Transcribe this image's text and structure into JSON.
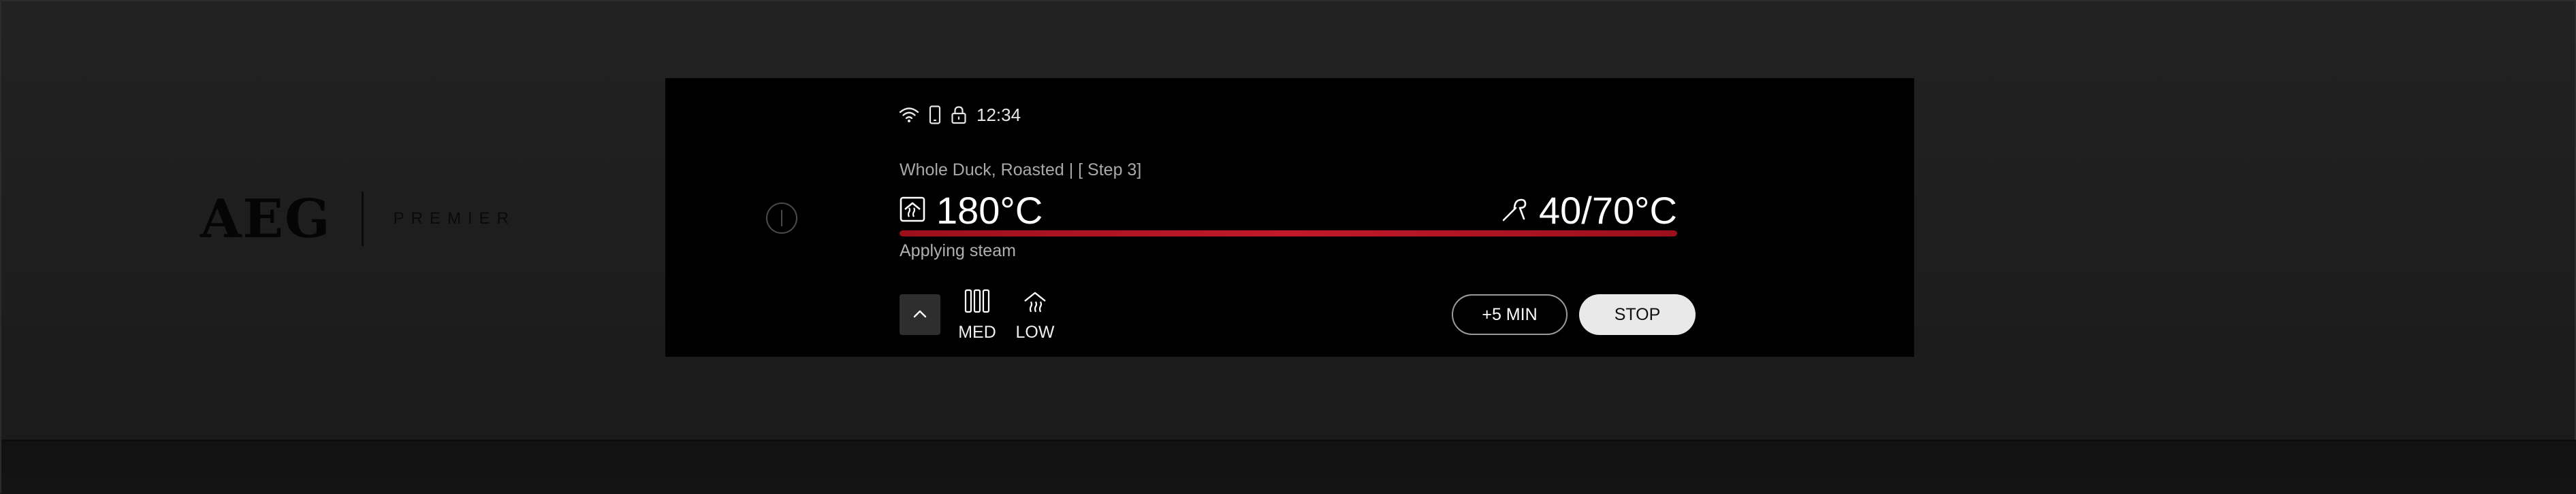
{
  "brand": {
    "logo": "AEG",
    "line": "PREMIER"
  },
  "status_bar": {
    "icons": [
      "wifi-icon",
      "phone-icon",
      "lock-icon"
    ],
    "time": "12:34"
  },
  "program": {
    "title": "Whole Duck, Roasted | [ Step 3]"
  },
  "oven": {
    "icon": "oven-heat-icon",
    "temperature": "180°C"
  },
  "probe": {
    "icon": "meat-probe-icon",
    "temperature": "40/70°C"
  },
  "progress": {
    "fraction": 1.0,
    "color": "#b3121f"
  },
  "phase": {
    "text": "Applying steam"
  },
  "controls": {
    "up_icon": "chevron-up-icon",
    "steam_level": {
      "icon": "steam-level-icon",
      "label": "MED"
    },
    "fan_level": {
      "icon": "fan-level-icon",
      "label": "LOW"
    },
    "plus_label": "+5 MIN",
    "stop_label": "STOP"
  }
}
